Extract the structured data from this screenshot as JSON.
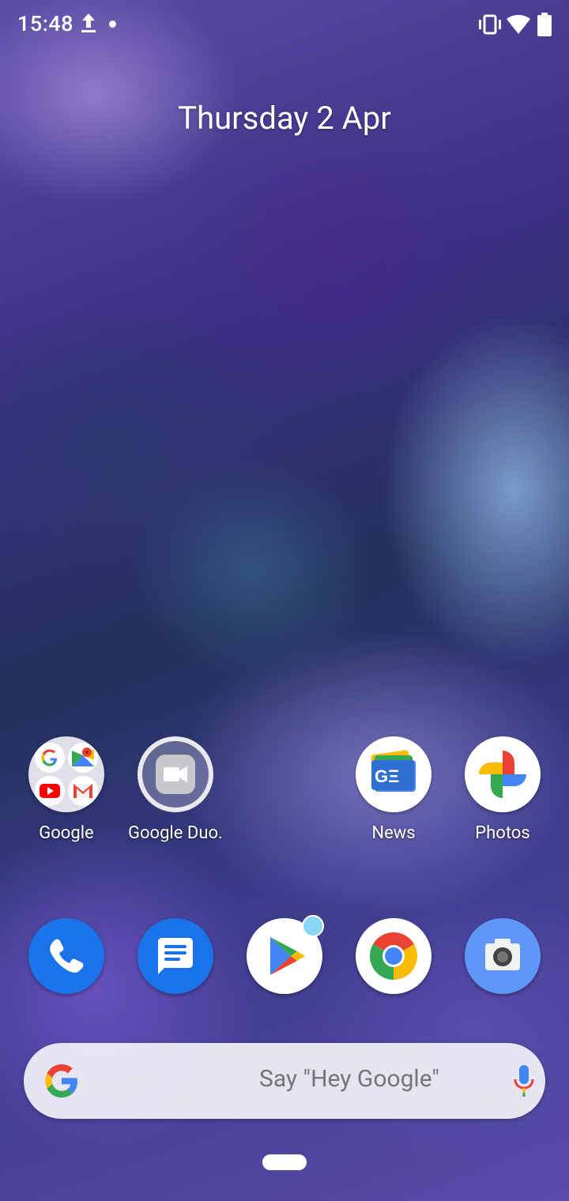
{
  "status_bar": {
    "time": "15:48",
    "icons": [
      "upload-icon",
      "notification-dot",
      "vibrate-icon",
      "wifi-icon",
      "battery-icon"
    ]
  },
  "date_widget": {
    "text": "Thursday 2 Apr"
  },
  "home_apps": [
    {
      "label": "Google",
      "type": "folder",
      "contains": [
        "google-icon",
        "maps-icon",
        "youtube-icon",
        "gmail-icon"
      ]
    },
    {
      "label": "Google Duo…",
      "icon": "duo-icon"
    },
    {
      "label": "News",
      "icon": "news-icon"
    },
    {
      "label": "Photos",
      "icon": "photos-icon"
    }
  ],
  "dock": [
    {
      "name": "Phone",
      "icon": "phone-icon",
      "color": "#1a73e8"
    },
    {
      "name": "Messages",
      "icon": "messages-icon",
      "color": "#1a73e8"
    },
    {
      "name": "Play Store",
      "icon": "play-store-icon",
      "has_badge": true
    },
    {
      "name": "Chrome",
      "icon": "chrome-icon"
    },
    {
      "name": "Camera",
      "icon": "camera-icon",
      "color": "#5e97f6"
    }
  ],
  "search": {
    "hint": "Say \"Hey Google\""
  },
  "colors": {
    "google_blue": "#4285f4",
    "google_red": "#ea4335",
    "google_yellow": "#fbbc05",
    "google_green": "#34a853"
  }
}
